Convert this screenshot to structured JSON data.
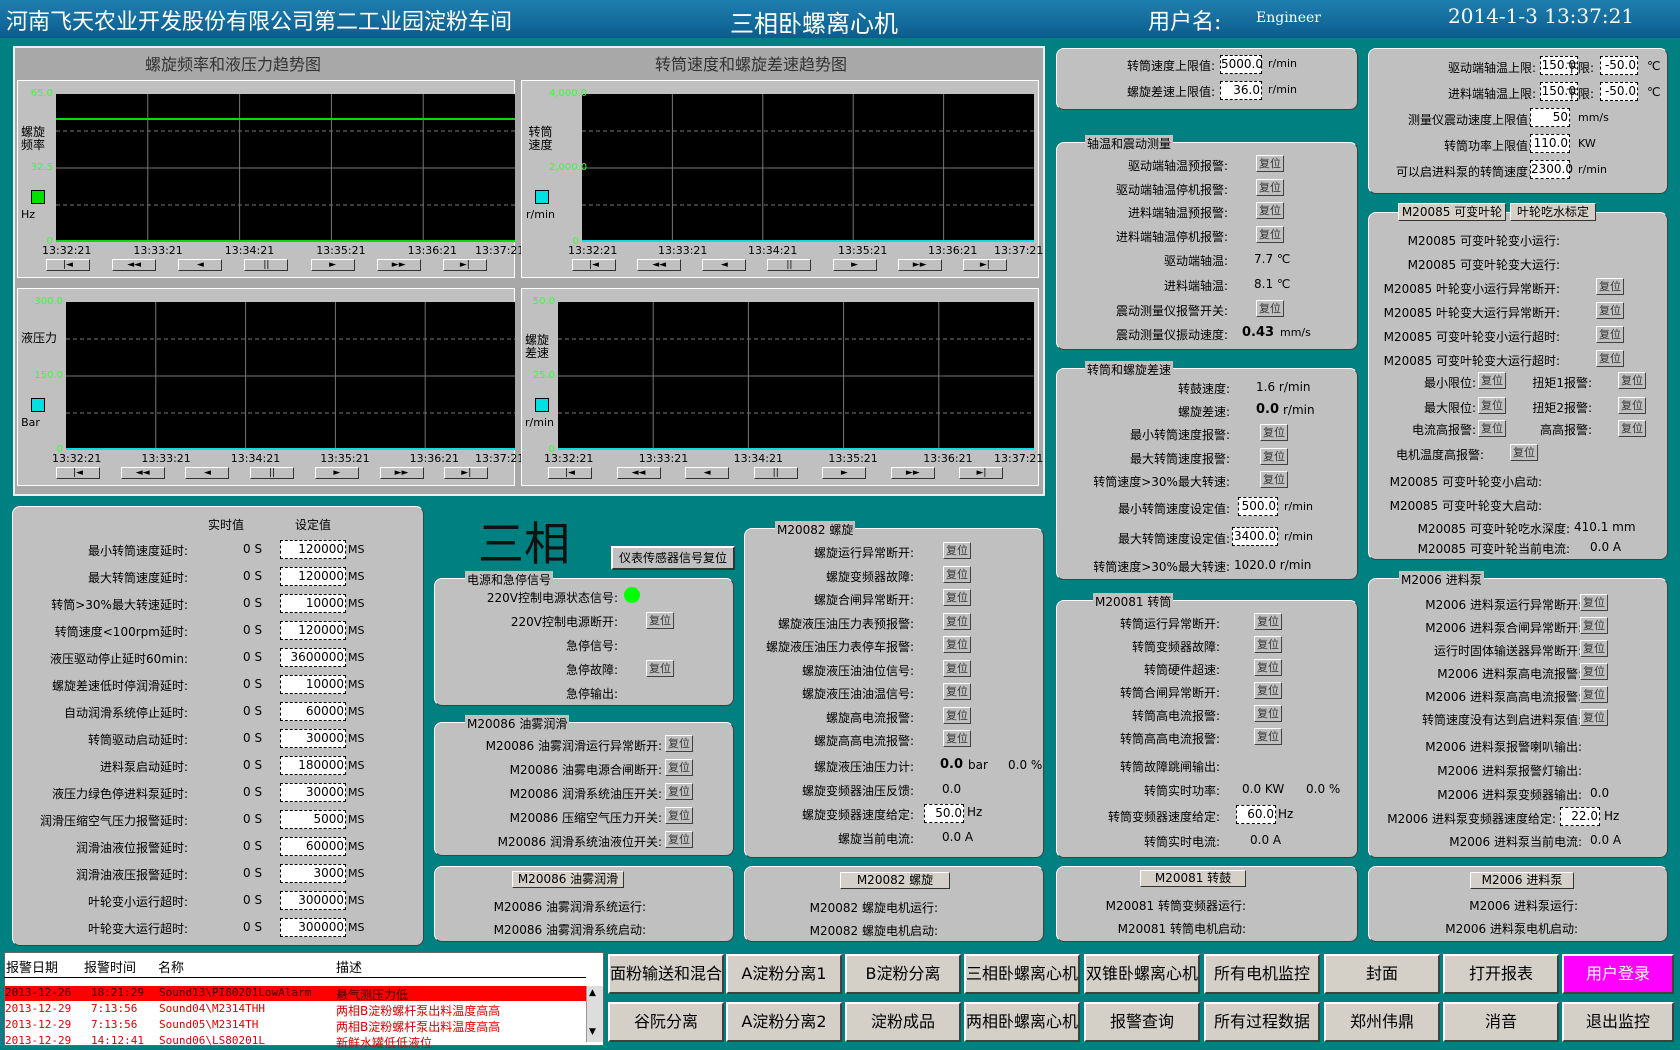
{
  "header": {
    "company": "河南飞天农业开发股份有限公司第二工业园淀粉车间",
    "title": "三相卧螺离心机",
    "user_label": "用户名:",
    "user": "Engineer",
    "datetime": "2014-1-3 13:37:21"
  },
  "charts": {
    "left_title": "螺旋频率和液压力趋势图",
    "right_title": "转筒速度和螺旋差速趋势图",
    "c1": {
      "label": "螺旋\n频率",
      "unit": "Hz",
      "ticks": [
        "65.0",
        "32.5",
        "0"
      ],
      "color": "#00e000",
      "line": {
        "value": 54,
        "min": 0,
        "max": 65,
        "color": "#00e000"
      }
    },
    "c2": {
      "label": "转筒\n速度",
      "unit": "r/min",
      "ticks": [
        "4,000.0",
        "2,000.0",
        "0"
      ],
      "color": "#00e0e0"
    },
    "c3": {
      "label": "液压力",
      "unit": "Bar",
      "ticks": [
        "300.0",
        "150.0",
        "0"
      ],
      "color": "#00e0e0"
    },
    "c4": {
      "label": "螺旋\n差速",
      "unit": "r/min",
      "ticks": [
        "50.0",
        "25.0",
        "0"
      ],
      "color": "#00e0e0"
    },
    "xticks": [
      "13:32:21",
      "13:33:21",
      "13:34:21",
      "13:35:21",
      "13:36:21",
      "13:37:21"
    ],
    "playback": [
      "|◄",
      "◄◄",
      "◄",
      "||",
      "►",
      "►►",
      "►|"
    ]
  },
  "delays": {
    "col_actual": "实时值",
    "col_set": "设定值",
    "big_title": "三相",
    "rows": [
      {
        "label": "最小转筒速度延时:",
        "actual": "0 S",
        "set": "120000",
        "unit": "MS"
      },
      {
        "label": "最大转筒速度延时:",
        "actual": "0 S",
        "set": "120000",
        "unit": "MS"
      },
      {
        "label": "转筒>30%最大转速延时:",
        "actual": "0 S",
        "set": "10000",
        "unit": "MS"
      },
      {
        "label": "转筒速度<100rpm延时:",
        "actual": "0 S",
        "set": "120000",
        "unit": "MS"
      },
      {
        "label": "液压驱动停止延时60min:",
        "actual": "0 S",
        "set": "3600000",
        "unit": "MS"
      },
      {
        "label": "螺旋差速低时停润滑延时:",
        "actual": "0 S",
        "set": "10000",
        "unit": "MS"
      },
      {
        "label": "自动润滑系统停止延时:",
        "actual": "0 S",
        "set": "60000",
        "unit": "MS"
      },
      {
        "label": "转筒驱动启动延时:",
        "actual": "0 S",
        "set": "30000",
        "unit": "MS"
      },
      {
        "label": "进料泵启动延时:",
        "actual": "0 S",
        "set": "180000",
        "unit": "MS"
      },
      {
        "label": "液压力绿色停进料泵延时:",
        "actual": "0 S",
        "set": "30000",
        "unit": "MS"
      },
      {
        "label": "润滑压缩空气压力报警延时:",
        "actual": "0 S",
        "set": "5000",
        "unit": "MS"
      },
      {
        "label": "润滑油液位报警延时:",
        "actual": "0 S",
        "set": "60000",
        "unit": "MS"
      },
      {
        "label": "润滑油液压报警延时:",
        "actual": "0 S",
        "set": "3000",
        "unit": "MS"
      },
      {
        "label": "叶轮变小运行超时:",
        "actual": "0 S",
        "set": "300000",
        "unit": "MS"
      },
      {
        "label": "叶轮变大运行超时:",
        "actual": "0 S",
        "set": "300000",
        "unit": "MS"
      }
    ]
  },
  "reset_label": "复位",
  "sensor_reset": "仪表传感器信号复位",
  "power": {
    "title": "电源和急停信号",
    "rows": [
      "220V控制电源状态信号:",
      "220V控制电源断开:",
      "急停信号:",
      "急停故障:",
      "急停输出:"
    ]
  },
  "oil": {
    "title": "M20086 油雾润滑",
    "rows": [
      "M20086 油雾润滑运行异常断开:",
      "M20086 油雾电源合闸断开:",
      "M20086 润滑系统油压开关:",
      "M20086 压缩空气压力开关:",
      "M20086 润滑系统油液位开关:"
    ]
  },
  "oil_bottom": {
    "button": "M20086 油雾润滑",
    "rows": [
      "M20086 油雾润滑系统运行:",
      "M20086 油雾润滑系统启动:"
    ]
  },
  "screw": {
    "title": "M20082 螺旋",
    "rows": [
      "螺旋运行异常断开:",
      "螺旋变频器故障:",
      "螺旋合闸异常断开:",
      "螺旋液压油压力表预报警:",
      "螺旋液压油压力表停车报警:",
      "螺旋液压油油位信号:",
      "螺旋液压油油温信号:",
      "螺旋高电流报警:",
      "螺旋高高电流报警:"
    ],
    "pressure_label": "螺旋液压油压力计:",
    "pressure": "0.0",
    "pressure_unit": "bar",
    "pressure_pct": "0.0 %",
    "fb_label": "螺旋变频器油压反馈:",
    "fb": "0.0",
    "speed_label": "螺旋变频器速度给定:",
    "speed": "50.0",
    "speed_unit": "Hz",
    "cur_label": "螺旋当前电流:",
    "cur": "0.0 A"
  },
  "screw_bottom": {
    "button": "M20082 螺旋",
    "rows": [
      "M20082 螺旋电机运行:",
      "M20082 螺旋电机启动:"
    ]
  },
  "limits1": {
    "rows": [
      {
        "label": "转筒速度上限值:",
        "value": "5000.0",
        "unit": "r/min"
      },
      {
        "label": "螺旋差速上限值:",
        "value": "36.0",
        "unit": "r/min"
      }
    ]
  },
  "vib": {
    "title": "轴温和震动测量",
    "rows": [
      "驱动端轴温预报警:",
      "驱动端轴温停机报警:",
      "进料端轴温预报警:",
      "进料端轴温停机报警:"
    ],
    "t1_label": "驱动端轴温:",
    "t1": "7.7 ℃",
    "t2_label": "进料端轴温:",
    "t2": "8.1 ℃",
    "sw_label": "震动测量仪报警开关:",
    "v_label": "震动测量仪振动速度:",
    "v": "0.43",
    "v_unit": "mm/s"
  },
  "drum": {
    "title": "转筒和螺旋差速",
    "speed_label": "转鼓速度:",
    "speed": "1.6 r/min",
    "diff_label": "螺旋差速:",
    "diff": "0.0",
    "diff_unit": "r/min",
    "rows": [
      "最小转筒速度报警:",
      "最大转筒速度报警:",
      "转筒速度>30%最大转速:"
    ],
    "min_label": "最小转筒速度设定值:",
    "min": "500.0",
    "max_label": "最大转筒速度设定值:",
    "max": "3400.0",
    "unit": "r/min",
    "pct_label": "转筒速度>30%最大转速:",
    "pct": "1020.0 r/min"
  },
  "m81": {
    "title": "M20081 转筒",
    "rows": [
      "转筒运行异常断开:",
      "转筒变频器故障:",
      "转筒硬件超速:",
      "转筒合闸异常断开:",
      "转筒高电流报警:",
      "转筒高高电流报警:"
    ],
    "trip_label": "转筒故障跳闸输出:",
    "pw_label": "转筒实时功率:",
    "pw": "0.0 KW",
    "pw_pct": "0.0 %",
    "sp_label": "转筒变频器速度给定:",
    "sp": "60.0",
    "sp_unit": "Hz",
    "cur_label": "转筒实时电流:",
    "cur": "0.0 A"
  },
  "m81_bottom": {
    "button": "M20081 转鼓",
    "rows": [
      "M20081 转筒变频器运行:",
      "M20081 转筒电机启动:"
    ]
  },
  "limits2": {
    "d_label": "驱动端轴温上限:",
    "d_hi": "150.0",
    "low_label": "下限:",
    "d_lo": "-50.0",
    "f_label": "进料端轴温上限:",
    "f_hi": "150.0",
    "f_lo": "-50.0",
    "deg": "℃",
    "v_label": "测量仪震动速度上限值:",
    "v": "50",
    "v_unit": "mm/s",
    "p_label": "转筒功率上限值:",
    "p": "110.0",
    "p_unit": "KW",
    "s_label": "可以启进料泵的转筒速度:",
    "s": "2300.0",
    "s_unit": "r/min"
  },
  "m85": {
    "btn1": "M20085 可变叶轮",
    "btn2": "叶轮吃水标定",
    "rows_plain": [
      "M20085 可变叶轮变小运行:",
      "M20085 可变叶轮变大运行:"
    ],
    "rows_reset": [
      "M20085 叶轮变小运行异常断开:",
      "M20085 叶轮变大运行异常断开:",
      "M20085 可变叶轮变小运行超时:",
      "M20085 可变叶轮变大运行超时:"
    ],
    "min_lim": "最小限位:",
    "max_lim": "最大限位:",
    "t1": "扭矩1报警:",
    "t2": "扭矩2报警:",
    "cur_hi": "电流高报警:",
    "cur_hihi": "高高报警:",
    "mt": "电机温度高报警:",
    "start1": "M20085 可变叶轮变小启动:",
    "start2": "M20085 可变叶轮变大启动:",
    "depth_label": "M20085 可变叶轮吃水深度:",
    "depth": "410.1 mm",
    "cur_label": "M20085 可变叶轮当前电流:",
    "cur": "0.0 A"
  },
  "m06": {
    "title": "M2006 进料泵",
    "rows": [
      "M2006 进料泵运行异常断开:",
      "M2006 进料泵合闸异常断开:",
      "运行时固体输送器异常断开:",
      "M2006 进料泵高电流报警:",
      "M2006 进料泵高高电流报警:",
      "转筒速度没有达到启进料泵值:"
    ],
    "horn": "M2006 进料泵报警喇叭输出:",
    "lamp": "M2006 进料泵报警灯输出:",
    "vfd_label": "M2006 进料泵变频器输出:",
    "vfd": "0.0",
    "sp_label": "M2006 进料泵变频器速度给定:",
    "sp": "22.0",
    "sp_unit": "Hz",
    "cur_label": "M2006 进料泵当前电流:",
    "cur": "0.0 A"
  },
  "m06_bottom": {
    "button": "M2006 进料泵",
    "rows": [
      "M2006 进料泵运行:",
      "M2006 进料泵电机启动:"
    ]
  },
  "alarms": {
    "headers": [
      "报警日期",
      "报警时间",
      "名称",
      "描述"
    ],
    "rows": [
      {
        "date": "2013-12-26",
        "time": "18:21:29",
        "name": "Sound13\\PI80201LowAlarm",
        "desc": "悬气测压力低"
      },
      {
        "date": "2013-12-29",
        "time": "7:13:56",
        "name": "Sound04\\M2314THH",
        "desc": "两相B淀粉螺杆泵出料温度高高"
      },
      {
        "date": "2013-12-29",
        "time": "7:13:56",
        "name": "Sound05\\M2314TH",
        "desc": "两相B淀粉螺杆泵出料温度高高"
      },
      {
        "date": "2013-12-29",
        "time": "14:12:41",
        "name": "Sound06\\LS80201L",
        "desc": "新鲜水罐低低液位"
      }
    ]
  },
  "nav": {
    "row1": [
      "面粉输送和混合",
      "A淀粉分离1",
      "B淀粉分离",
      "三相卧螺离心机",
      "双锥卧螺离心机",
      "所有电机监控",
      "封面",
      "打开报表",
      "用户登录"
    ],
    "row2": [
      "谷阮分离",
      "A淀粉分离2",
      "淀粉成品",
      "两相卧螺离心机",
      "报警查询",
      "所有过程数据",
      "郑州伟鼎",
      "消音",
      "退出监控"
    ]
  },
  "colors": {
    "bg": "#008080",
    "panel": "#c0c0c0",
    "alarm": "#ff0000",
    "login": "#ff00ff",
    "status_on": "#00ff00"
  }
}
